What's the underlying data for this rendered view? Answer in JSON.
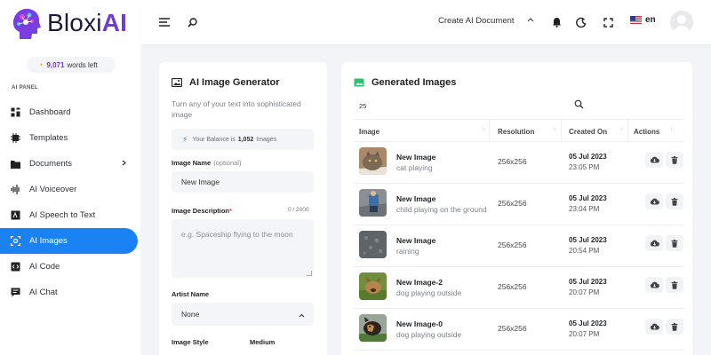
{
  "brand": {
    "name_prefix": "Bloxi",
    "name_suffix": "AI",
    "accent": "#1b82f3",
    "brand_purple": "#6f3cd6"
  },
  "header": {
    "create_document": "Create AI Document",
    "language": "en",
    "icons": [
      "menu-icon",
      "search-icon",
      "bell-icon",
      "moon-icon",
      "fullscreen-icon",
      "chevron-up-icon"
    ]
  },
  "sidebar": {
    "words_left_count": "9,071",
    "words_left_label": "words left",
    "section_label": "AI PANEL",
    "items": [
      {
        "label": "Dashboard",
        "icon": "dashboard-icon"
      },
      {
        "label": "Templates",
        "icon": "templates-icon"
      },
      {
        "label": "Documents",
        "icon": "folder-icon"
      },
      {
        "label": "AI Voiceover",
        "icon": "waveform-icon"
      },
      {
        "label": "AI Speech to Text",
        "icon": "speech-icon"
      },
      {
        "label": "AI Images",
        "icon": "image-scan-icon"
      },
      {
        "label": "AI Code",
        "icon": "code-icon"
      },
      {
        "label": "AI Chat",
        "icon": "chat-icon"
      }
    ],
    "active": "AI Images"
  },
  "generator": {
    "title": "AI Image Generator",
    "subtitle": "Turn any of your text into sophisticated image",
    "balance_prefix": "Your Balance is",
    "balance_value": "1,052",
    "balance_suffix": "Images",
    "image_name_label": "Image Name",
    "image_name_optional": "(optional)",
    "image_name_value": "New Image",
    "description_label": "Image Description",
    "description_required": "*",
    "description_counter": "0 / 2000",
    "description_placeholder": "e.g. Spaceship flying to the moon",
    "artist_label": "Artist Name",
    "artist_value": "None",
    "style_label": "Image Style",
    "medium_label": "Medium"
  },
  "generated": {
    "title": "Generated Images",
    "page_size": "25",
    "columns": [
      "Image",
      "Resolution",
      "Created On",
      "Actions"
    ],
    "rows": [
      {
        "name": "New Image",
        "desc": "cat playing",
        "res": "256x256",
        "date": "05 Jul 2023",
        "time": "23:05 PM"
      },
      {
        "name": "New Image",
        "desc": "child playing on the ground",
        "res": "256x256",
        "date": "05 Jul 2023",
        "time": "23:04 PM"
      },
      {
        "name": "New Image",
        "desc": "raining",
        "res": "256x256",
        "date": "05 Jul 2023",
        "time": "20:54 PM"
      },
      {
        "name": "New Image-2",
        "desc": "dog playing outside",
        "res": "256x256",
        "date": "05 Jul 2023",
        "time": "20:07 PM"
      },
      {
        "name": "New Image-0",
        "desc": "dog playing outside",
        "res": "256x256",
        "date": "05 Jul 2023",
        "time": "20:07 PM"
      }
    ]
  }
}
